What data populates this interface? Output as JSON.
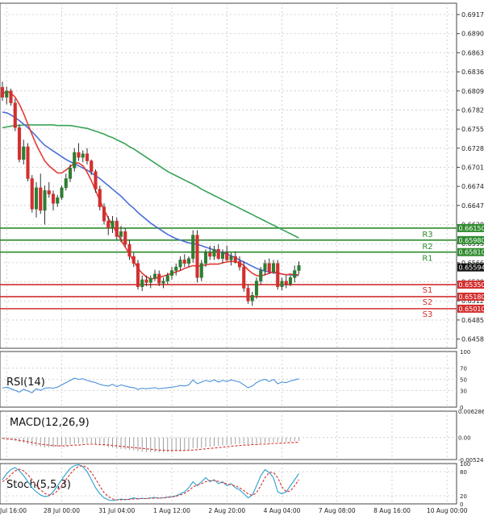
{
  "colors": {
    "up": "#2e7d32",
    "down": "#d32f2f",
    "sma_fast": "#e53935",
    "sma_mid": "#4a6fd8",
    "sma_slow": "#3aa356",
    "resistance": "#2e8b2e",
    "support": "#d32f2f",
    "rsi": "#4a90d9",
    "macd_signal": "#d32f2f",
    "macd_hist": "#9e9e9e",
    "stoch_k": "#29a3d1",
    "stoch_d": "#d32f2f",
    "grid": "#c8c8c8"
  },
  "chart_data": [
    {
      "type": "candlestick",
      "panel": "price",
      "ylim": [
        0.6445,
        0.6933
      ],
      "y_ticks": [
        0.6917,
        0.689,
        0.6863,
        0.6836,
        0.6809,
        0.6782,
        0.6755,
        0.6728,
        0.6701,
        0.6674,
        0.6647,
        0.662,
        0.6593,
        0.6566,
        0.6539,
        0.6512,
        0.6485,
        0.6458
      ],
      "y_tick_labels": [
        "0.69170",
        "0.68900",
        "0.68630",
        "0.68360",
        "0.68090",
        "0.67820",
        "0.67550",
        "0.67280",
        "0.67010",
        "0.66740",
        "0.66470",
        "0.66200",
        "0.65930",
        "0.65660",
        "0.65390",
        "0.65120",
        "0.64850",
        "0.64580"
      ],
      "x_tick_labels": [
        "Jul 16:00",
        "28 Jul 00:00",
        "31 Jul 04:00",
        "1 Aug 12:00",
        "2 Aug 20:00",
        "4 Aug 04:00",
        "7 Aug 08:00",
        "8 Aug 16:00",
        "10 Aug 00:00"
      ],
      "x_tick_index": [
        1,
        14,
        27,
        40,
        53,
        66,
        79,
        92,
        105
      ],
      "candles": [
        [
          0.6814,
          0.6822,
          0.6795,
          0.68
        ],
        [
          0.68,
          0.6815,
          0.679,
          0.6809
        ],
        [
          0.6809,
          0.6812,
          0.6788,
          0.6792
        ],
        [
          0.6792,
          0.6798,
          0.6752,
          0.6757
        ],
        [
          0.6757,
          0.6762,
          0.6708,
          0.6712
        ],
        [
          0.6712,
          0.674,
          0.6705,
          0.673
        ],
        [
          0.673,
          0.6735,
          0.6681,
          0.6685
        ],
        [
          0.6685,
          0.669,
          0.6637,
          0.6642
        ],
        [
          0.6642,
          0.668,
          0.663,
          0.6672
        ],
        [
          0.6672,
          0.6692,
          0.6635,
          0.664
        ],
        [
          0.664,
          0.6675,
          0.662,
          0.6668
        ],
        [
          0.6668,
          0.668,
          0.6658,
          0.6663
        ],
        [
          0.6663,
          0.6668,
          0.664,
          0.665
        ],
        [
          0.665,
          0.6662,
          0.6645,
          0.6658
        ],
        [
          0.6658,
          0.6675,
          0.6655,
          0.6672
        ],
        [
          0.6672,
          0.6692,
          0.6668,
          0.6685
        ],
        [
          0.6685,
          0.6705,
          0.668,
          0.67
        ],
        [
          0.67,
          0.6728,
          0.6695,
          0.6722
        ],
        [
          0.6722,
          0.6735,
          0.671,
          0.6715
        ],
        [
          0.6715,
          0.6725,
          0.6708,
          0.672
        ],
        [
          0.672,
          0.6728,
          0.6705,
          0.671
        ],
        [
          0.671,
          0.6712,
          0.669,
          0.6695
        ],
        [
          0.6695,
          0.6698,
          0.6665,
          0.667
        ],
        [
          0.667,
          0.6675,
          0.664,
          0.6645
        ],
        [
          0.6645,
          0.665,
          0.662,
          0.6625
        ],
        [
          0.6625,
          0.6632,
          0.6605,
          0.6615
        ],
        [
          0.6615,
          0.6632,
          0.6608,
          0.6625
        ],
        [
          0.6625,
          0.663,
          0.6598,
          0.6603
        ],
        [
          0.6603,
          0.6618,
          0.6595,
          0.661
        ],
        [
          0.661,
          0.6615,
          0.6588,
          0.6592
        ],
        [
          0.6592,
          0.6598,
          0.657,
          0.6575
        ],
        [
          0.6575,
          0.658,
          0.656,
          0.6565
        ],
        [
          0.6565,
          0.657,
          0.6528,
          0.6532
        ],
        [
          0.6532,
          0.6548,
          0.6526,
          0.6542
        ],
        [
          0.6542,
          0.6548,
          0.6533,
          0.6538
        ],
        [
          0.6538,
          0.6548,
          0.653,
          0.6544
        ],
        [
          0.6544,
          0.6556,
          0.654,
          0.655
        ],
        [
          0.655,
          0.6555,
          0.6533,
          0.6537
        ],
        [
          0.6537,
          0.6545,
          0.653,
          0.654
        ],
        [
          0.654,
          0.6552,
          0.6536,
          0.6548
        ],
        [
          0.6548,
          0.656,
          0.6542,
          0.6555
        ],
        [
          0.6555,
          0.6565,
          0.6548,
          0.656
        ],
        [
          0.656,
          0.6575,
          0.6555,
          0.657
        ],
        [
          0.657,
          0.6578,
          0.656,
          0.6565
        ],
        [
          0.6565,
          0.6575,
          0.656,
          0.6572
        ],
        [
          0.6572,
          0.6612,
          0.6566,
          0.6605
        ],
        [
          0.6605,
          0.6612,
          0.6538,
          0.6545
        ],
        [
          0.6545,
          0.657,
          0.654,
          0.6565
        ],
        [
          0.6565,
          0.6585,
          0.656,
          0.658
        ],
        [
          0.658,
          0.659,
          0.657,
          0.6575
        ],
        [
          0.6575,
          0.659,
          0.657,
          0.6585
        ],
        [
          0.6585,
          0.6592,
          0.657,
          0.6572
        ],
        [
          0.6572,
          0.6585,
          0.6565,
          0.658
        ],
        [
          0.658,
          0.659,
          0.6568,
          0.657
        ],
        [
          0.657,
          0.658,
          0.6562,
          0.6575
        ],
        [
          0.6575,
          0.6582,
          0.6565,
          0.6568
        ],
        [
          0.6568,
          0.6575,
          0.6555,
          0.656
        ],
        [
          0.656,
          0.6568,
          0.6525,
          0.653
        ],
        [
          0.653,
          0.6535,
          0.6508,
          0.6512
        ],
        [
          0.6512,
          0.6525,
          0.6505,
          0.652
        ],
        [
          0.652,
          0.6545,
          0.6515,
          0.654
        ],
        [
          0.654,
          0.656,
          0.6535,
          0.6555
        ],
        [
          0.6555,
          0.657,
          0.6548,
          0.6565
        ],
        [
          0.6565,
          0.6572,
          0.655,
          0.6553
        ],
        [
          0.6553,
          0.657,
          0.655,
          0.6565
        ],
        [
          0.6565,
          0.657,
          0.6528,
          0.6532
        ],
        [
          0.6532,
          0.6545,
          0.6527,
          0.654
        ],
        [
          0.654,
          0.6548,
          0.653,
          0.6536
        ],
        [
          0.6536,
          0.6548,
          0.6533,
          0.6545
        ],
        [
          0.6545,
          0.6562,
          0.6538,
          0.6555
        ],
        [
          0.6555,
          0.6568,
          0.655,
          0.6562
        ]
      ],
      "sma_fast": [
        0.6805,
        0.6808,
        0.6806,
        0.68,
        0.679,
        0.6777,
        0.6762,
        0.6747,
        0.6733,
        0.6721,
        0.671,
        0.6703,
        0.6698,
        0.6693,
        0.6693,
        0.6697,
        0.6702,
        0.6707,
        0.6707,
        0.6703,
        0.6694,
        0.6682,
        0.6668,
        0.6654,
        0.6641,
        0.6629,
        0.6619,
        0.6608,
        0.6598,
        0.6588,
        0.6578,
        0.6568,
        0.6558,
        0.6551,
        0.6546,
        0.6543,
        0.6544,
        0.6545,
        0.6547,
        0.6549,
        0.6551,
        0.6553,
        0.6555,
        0.6558,
        0.656,
        0.6562,
        0.6561,
        0.6562,
        0.6563,
        0.6564,
        0.6564,
        0.6564,
        0.6566,
        0.6567,
        0.6568,
        0.6567,
        0.6566,
        0.6562,
        0.6556,
        0.6551,
        0.6548,
        0.6547,
        0.6549,
        0.6551,
        0.6553,
        0.6552,
        0.655,
        0.6549,
        0.655,
        0.6549,
        0.6549
      ],
      "sma_mid": [
        0.6779,
        0.6778,
        0.6775,
        0.6771,
        0.6767,
        0.6762,
        0.6757,
        0.6751,
        0.6745,
        0.6738,
        0.6732,
        0.6728,
        0.6724,
        0.672,
        0.6716,
        0.6712,
        0.6709,
        0.6706,
        0.6703,
        0.67,
        0.6697,
        0.6693,
        0.6689,
        0.6685,
        0.668,
        0.6675,
        0.667,
        0.6665,
        0.666,
        0.6654,
        0.6648,
        0.6643,
        0.6637,
        0.6632,
        0.6627,
        0.6622,
        0.6618,
        0.6614,
        0.661,
        0.6606,
        0.6603,
        0.66,
        0.6598,
        0.6596,
        0.6594,
        0.6593,
        0.6592,
        0.659,
        0.6588,
        0.6586,
        0.6584,
        0.6582,
        0.658,
        0.6578,
        0.6576,
        0.6573,
        0.657,
        0.6567,
        0.6564,
        0.6561,
        0.6558,
        0.6556,
        0.6554,
        0.6553,
        0.6552,
        0.6551,
        0.655,
        0.6549,
        0.6549,
        0.6548,
        0.6548
      ],
      "sma_slow": [
        0.6757,
        0.6758,
        0.6759,
        0.676,
        0.676,
        0.6761,
        0.6761,
        0.6761,
        0.6761,
        0.6761,
        0.6761,
        0.6761,
        0.6761,
        0.676,
        0.676,
        0.676,
        0.676,
        0.6759,
        0.6758,
        0.6757,
        0.6756,
        0.6754,
        0.6752,
        0.675,
        0.6748,
        0.6745,
        0.6743,
        0.674,
        0.6737,
        0.6734,
        0.673,
        0.6727,
        0.6723,
        0.6719,
        0.6715,
        0.6711,
        0.6707,
        0.6703,
        0.6699,
        0.6695,
        0.6692,
        0.6689,
        0.6686,
        0.6683,
        0.668,
        0.6677,
        0.6674,
        0.667,
        0.6667,
        0.6664,
        0.6661,
        0.6658,
        0.6655,
        0.6652,
        0.6649,
        0.6646,
        0.6643,
        0.664,
        0.6637,
        0.6634,
        0.6631,
        0.6628,
        0.6625,
        0.6622,
        0.6619,
        0.6616,
        0.6613,
        0.661,
        0.6607,
        0.6604,
        0.6601
      ],
      "levels": [
        {
          "name": "R3",
          "value": 0.6615,
          "label": "0.66150",
          "kind": "resistance"
        },
        {
          "name": "R2",
          "value": 0.6598,
          "label": "0.65980",
          "kind": "resistance"
        },
        {
          "name": "R1",
          "value": 0.6581,
          "label": "0.65810",
          "kind": "resistance"
        },
        {
          "name": "S1",
          "value": 0.6535,
          "label": "0.65350",
          "kind": "support"
        },
        {
          "name": "S2",
          "value": 0.6518,
          "label": "0.65180",
          "kind": "support"
        },
        {
          "name": "S3",
          "value": 0.6501,
          "label": "0.65010",
          "kind": "support"
        }
      ],
      "current_price": {
        "value": 0.65594,
        "label": "0.65594"
      }
    },
    {
      "type": "line",
      "panel": "rsi",
      "title": "RSI(14)",
      "ylim": [
        0,
        100
      ],
      "y_tick_labels": [
        "100",
        "70",
        "50",
        "30",
        "0"
      ],
      "y_ticks": [
        100,
        70,
        50,
        30,
        0
      ],
      "values": [
        34,
        36,
        33,
        30,
        27,
        32,
        29,
        26,
        33,
        30,
        34,
        35,
        34,
        36,
        40,
        44,
        48,
        52,
        50,
        51,
        48,
        46,
        44,
        41,
        39,
        38,
        41,
        37,
        40,
        38,
        36,
        35,
        32,
        34,
        33,
        34,
        35,
        33,
        34,
        35,
        36,
        37,
        39,
        38,
        40,
        49,
        42,
        45,
        48,
        46,
        49,
        45,
        48,
        46,
        49,
        47,
        45,
        40,
        35,
        38,
        44,
        48,
        50,
        46,
        50,
        42,
        45,
        44,
        47,
        49,
        51
      ]
    },
    {
      "type": "bar",
      "panel": "macd",
      "title": "MACD(12,26,9)",
      "ylim": [
        -0.005248,
        0.006286
      ],
      "y_tick_labels": [
        "0.006286",
        "0.00",
        "-0.005248"
      ],
      "y_ticks": [
        0.006286,
        0.0,
        -0.005248
      ],
      "histogram": [
        -0.0003,
        -0.0004,
        -0.0006,
        -0.0008,
        -0.0011,
        -0.0013,
        -0.0016,
        -0.0019,
        -0.002,
        -0.0022,
        -0.0023,
        -0.0023,
        -0.0023,
        -0.0022,
        -0.0021,
        -0.0019,
        -0.0017,
        -0.0015,
        -0.0014,
        -0.0013,
        -0.0013,
        -0.0014,
        -0.0016,
        -0.0018,
        -0.0021,
        -0.0023,
        -0.0024,
        -0.0026,
        -0.0027,
        -0.0028,
        -0.003,
        -0.0031,
        -0.0033,
        -0.0034,
        -0.0035,
        -0.0035,
        -0.0035,
        -0.0035,
        -0.0035,
        -0.0034,
        -0.0033,
        -0.0032,
        -0.0031,
        -0.003,
        -0.0029,
        -0.0026,
        -0.0026,
        -0.0025,
        -0.0023,
        -0.0022,
        -0.0021,
        -0.002,
        -0.0019,
        -0.0018,
        -0.0017,
        -0.0016,
        -0.0015,
        -0.0015,
        -0.0016,
        -0.0016,
        -0.0015,
        -0.0014,
        -0.0013,
        -0.0012,
        -0.0011,
        -0.0011,
        -0.0011,
        -0.001,
        -0.001,
        -0.0009,
        -0.0008
      ],
      "signal": [
        -0.0002,
        -0.0003,
        -0.0004,
        -0.0005,
        -0.0007,
        -0.0008,
        -0.001,
        -0.0012,
        -0.0014,
        -0.0016,
        -0.0017,
        -0.0018,
        -0.0019,
        -0.002,
        -0.002,
        -0.002,
        -0.0019,
        -0.0018,
        -0.0018,
        -0.0017,
        -0.0016,
        -0.0016,
        -0.0016,
        -0.0017,
        -0.0017,
        -0.0018,
        -0.0019,
        -0.002,
        -0.0021,
        -0.0022,
        -0.0023,
        -0.0024,
        -0.0025,
        -0.0026,
        -0.0027,
        -0.0028,
        -0.0029,
        -0.003,
        -0.003,
        -0.0031,
        -0.0031,
        -0.0031,
        -0.0031,
        -0.0031,
        -0.003,
        -0.003,
        -0.0029,
        -0.0028,
        -0.0027,
        -0.0026,
        -0.0025,
        -0.0024,
        -0.0023,
        -0.0022,
        -0.0021,
        -0.002,
        -0.0019,
        -0.0018,
        -0.0018,
        -0.0017,
        -0.0017,
        -0.0016,
        -0.0016,
        -0.0015,
        -0.0014,
        -0.0014,
        -0.0013,
        -0.0013,
        -0.0012,
        -0.0012,
        -0.0011
      ]
    },
    {
      "type": "line",
      "panel": "stoch",
      "title": "Stoch(5,5,3)",
      "ylim": [
        0,
        100
      ],
      "y_tick_labels": [
        "100",
        "80",
        "20",
        "0"
      ],
      "y_ticks": [
        100,
        80,
        20,
        0
      ],
      "k": [
        60,
        75,
        85,
        90,
        82,
        70,
        55,
        40,
        30,
        22,
        18,
        20,
        30,
        45,
        60,
        75,
        88,
        95,
        97,
        92,
        80,
        60,
        40,
        25,
        15,
        10,
        8,
        10,
        12,
        10,
        12,
        15,
        12,
        14,
        13,
        15,
        16,
        14,
        15,
        17,
        18,
        20,
        25,
        30,
        40,
        55,
        45,
        55,
        65,
        55,
        60,
        50,
        55,
        45,
        50,
        40,
        35,
        25,
        15,
        22,
        45,
        70,
        85,
        78,
        65,
        30,
        25,
        30,
        45,
        60,
        75
      ],
      "d": [
        55,
        62,
        72,
        82,
        86,
        82,
        72,
        60,
        46,
        35,
        26,
        22,
        24,
        32,
        45,
        60,
        74,
        86,
        93,
        95,
        90,
        78,
        62,
        44,
        28,
        18,
        12,
        10,
        10,
        11,
        11,
        12,
        13,
        13,
        13,
        14,
        14,
        15,
        15,
        16,
        17,
        19,
        22,
        26,
        33,
        42,
        47,
        50,
        55,
        58,
        58,
        56,
        52,
        50,
        47,
        45,
        40,
        33,
        25,
        21,
        28,
        45,
        65,
        78,
        78,
        65,
        42,
        30,
        32,
        45,
        60
      ]
    }
  ]
}
